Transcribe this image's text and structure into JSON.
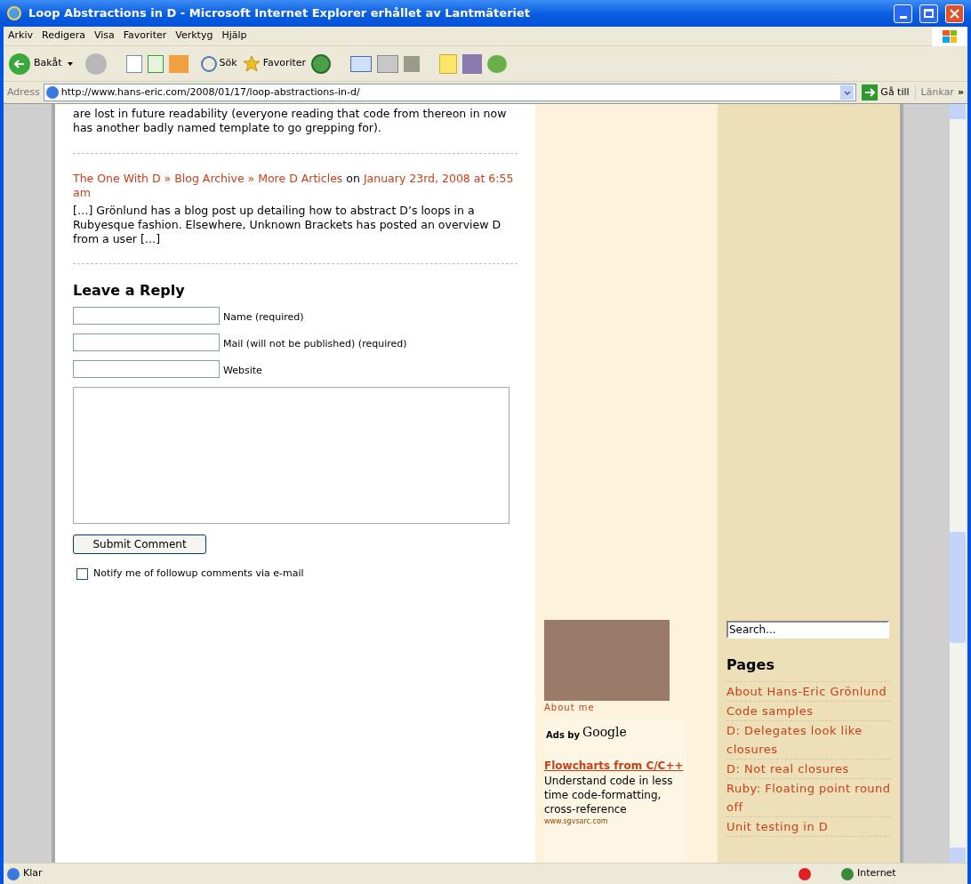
{
  "window": {
    "title": "Loop Abstractions in D - Microsoft Internet Explorer erhållet av Lantmäteriet"
  },
  "menu": [
    "Arkiv",
    "Redigera",
    "Visa",
    "Favoriter",
    "Verktyg",
    "Hjälp"
  ],
  "toolbar": {
    "back": "Bakåt",
    "search": "Sök",
    "favorites": "Favoriter"
  },
  "address": {
    "label": "Adress",
    "url": "http://www.hans-eric.com/2008/01/17/loop-abstractions-in-d/",
    "go": "Gå till",
    "links": "Länkar",
    "more": "»"
  },
  "post_tail": "are lost in future readability (everyone reading that code from thereon in now has another badly named template to go grepping for).",
  "comment": {
    "author": "The One With D » Blog Archive » More D Articles",
    "on": "on",
    "date": "January 23rd, 2008 at 6:55 am",
    "text": "[…] Grönlund has a blog post up detailing how to abstract D’s loops in a Rubyesque fashion. Elsewhere, Unknown Brackets has posted an overview D from a user […]"
  },
  "reply": {
    "title": "Leave a Reply",
    "fields": [
      {
        "label": "Name (required)"
      },
      {
        "label": "Mail (will not be published) (required)"
      },
      {
        "label": "Website"
      }
    ],
    "submit": "Submit Comment",
    "notify": {
      "label": "Notify me of followup comments via e-mail",
      "checked": false
    }
  },
  "sidebar": {
    "about": "About me",
    "ads_by": "Ads by",
    "ads_brand": "Google",
    "ad": {
      "title": "Flowcharts from C/C++",
      "text": "Understand code in less time code-formatting, cross-reference",
      "url": "www.sgvsarc.com"
    }
  },
  "sidebar2": {
    "search_placeholder": "Search...",
    "pages_title": "Pages",
    "pages": [
      "About Hans-Eric Grönlund",
      "Code samples",
      "D: Delegates look like closures",
      "D: Not real closures",
      "Ruby: Floating point round off",
      "Unit testing in D"
    ]
  },
  "status_bar": {
    "text": "Klar",
    "zone": "Internet"
  }
}
